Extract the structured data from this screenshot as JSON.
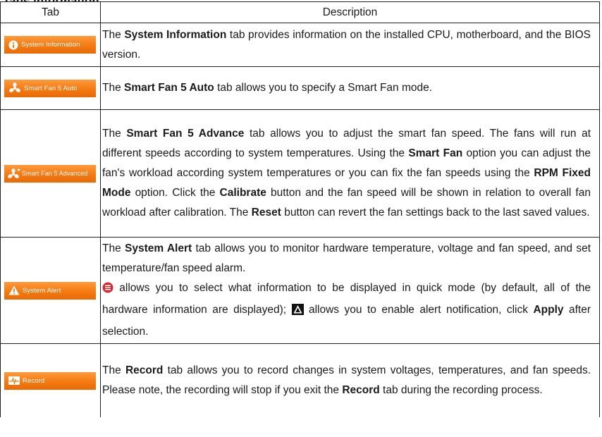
{
  "section_title": "Tabs Information",
  "table": {
    "headers": {
      "tab": "Tab",
      "description": "Description"
    },
    "rows": [
      {
        "tab_label": "System Information",
        "icon": "info-icon",
        "desc": {
          "p1": "The ",
          "b1": "System Information",
          "p2": " tab provides information on the installed CPU, motherboard, and the BIOS version."
        }
      },
      {
        "tab_label": "Smart Fan 5 Auto",
        "icon": "fan-icon",
        "desc": {
          "p1": "The ",
          "b1": "Smart Fan 5 Auto",
          "p2": " tab allows you to specify a Smart Fan mode."
        }
      },
      {
        "tab_label": "Smart Fan 5 Advanced",
        "icon": "fan-plus-icon",
        "desc": {
          "p1": "The ",
          "b1": "Smart Fan 5 Advance",
          "p2": " tab allows you to adjust the smart fan speed. The fans will run at different speeds according to system temperatures. Using the ",
          "b2": "Smart Fan",
          "p3": " option you can adjust the fan's workload according system temperatures or you can fix the fan speeds using the ",
          "b3": "RPM Fixed Mode",
          "p4": " option. Click the ",
          "b4": "Calibrate",
          "p5": " button and the fan speed will be shown in relation to overall fan workload after calibration. The ",
          "b5": "Reset",
          "p6": " button can revert the fan settings back to the last saved values."
        }
      },
      {
        "tab_label": "System Alert",
        "icon": "warning-icon",
        "desc": {
          "p1": "The ",
          "b1": "System Alert",
          "p2": " tab allows you to monitor hardware temperature, voltage and fan speed, and set temperature/fan speed alarm.",
          "p3": " allows you to select what information to be displayed in quick mode (by default, all of the hardware information are displayed); ",
          "p4": " allows you to enable alert notification, click ",
          "b2": "Apply",
          "p5": " after selection."
        }
      },
      {
        "tab_label": "Record",
        "icon": "pulse-icon",
        "desc": {
          "p1": "The ",
          "b1": "Record",
          "p2": " tab allows you to record changes in system voltages, temperatures, and fan speeds. Please note, the recording will stop if you exit the ",
          "b2": "Record",
          "p3": " tab during the recording process."
        }
      }
    ]
  },
  "colors": {
    "tab_orange": "#f47a12",
    "list_icon_red": "#e0262b",
    "border": "#222222"
  }
}
